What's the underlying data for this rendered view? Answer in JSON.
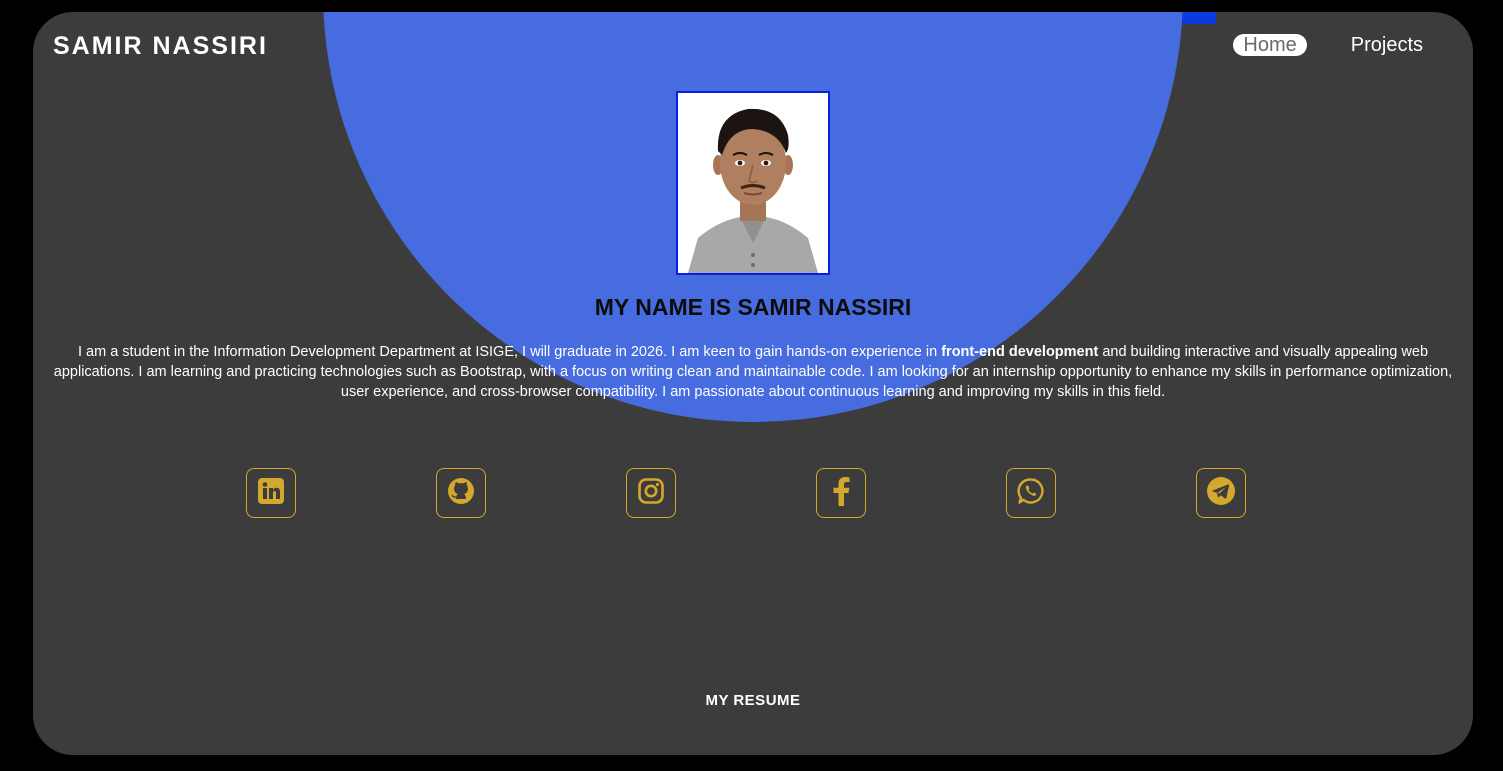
{
  "header": {
    "brand": "SAMIR NASSIRI",
    "nav": [
      {
        "label": "Home",
        "active": true
      },
      {
        "label": "Projects",
        "active": false
      }
    ]
  },
  "hero": {
    "headline": "MY NAME IS SAMIR NASSIRI",
    "bio_part1": "I am a student in the Information Development Department at ISIGE, I will graduate in 2026. I am keen to gain hands-on experience in ",
    "bio_strong": "front-end development",
    "bio_part2": " and building interactive and visually appealing web applications. I am learning and practicing technologies such as Bootstrap, with a focus on writing clean and maintainable code. I am looking for an internship opportunity to enhance my skills in performance optimization, user experience, and cross-browser compatibility. I am passionate about continuous learning and improving my skills in this field."
  },
  "socials": [
    {
      "icon": "linkedin-icon"
    },
    {
      "icon": "github-icon"
    },
    {
      "icon": "instagram-icon"
    },
    {
      "icon": "facebook-icon"
    },
    {
      "icon": "whatsapp-icon"
    },
    {
      "icon": "telegram-icon"
    }
  ],
  "footer": {
    "resume_label": "MY RESUME"
  },
  "colors": {
    "background": "#000000",
    "card": "#3c3c3c",
    "accent_blue": "#476ce0",
    "icon_gold": "#d4a82c"
  }
}
